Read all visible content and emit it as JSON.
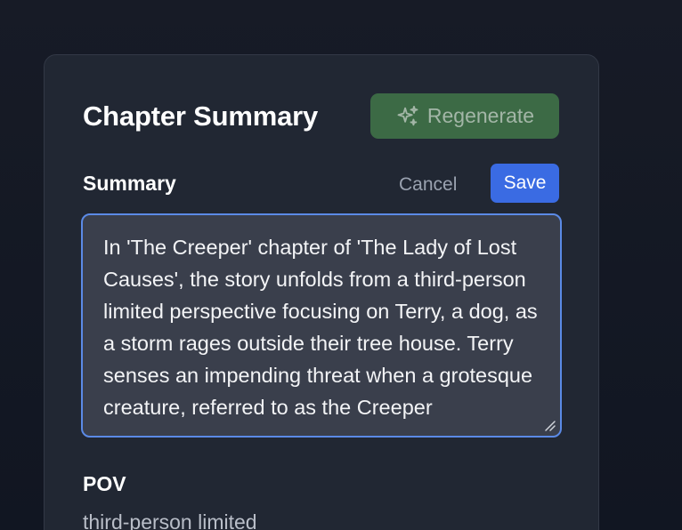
{
  "card": {
    "title": "Chapter Summary",
    "regenerate_label": "Regenerate",
    "regenerate_icon": "sparkles-icon"
  },
  "summary": {
    "label": "Summary",
    "cancel_label": "Cancel",
    "save_label": "Save",
    "text": "In 'The Creeper' chapter of 'The Lady of Lost Causes', the story unfolds from a third-person limited perspective focusing on Terry, a dog, as a storm rages outside their tree house. Terry senses an impending threat when a grotesque creature, referred to as the Creeper"
  },
  "pov": {
    "label": "POV",
    "value": "third-person limited"
  },
  "colors": {
    "background": "#131722",
    "card": "#212733",
    "regenerate_button": "#3c6a45",
    "save_button": "#3a6be3",
    "textarea_focus_border": "#5b8ae6"
  }
}
